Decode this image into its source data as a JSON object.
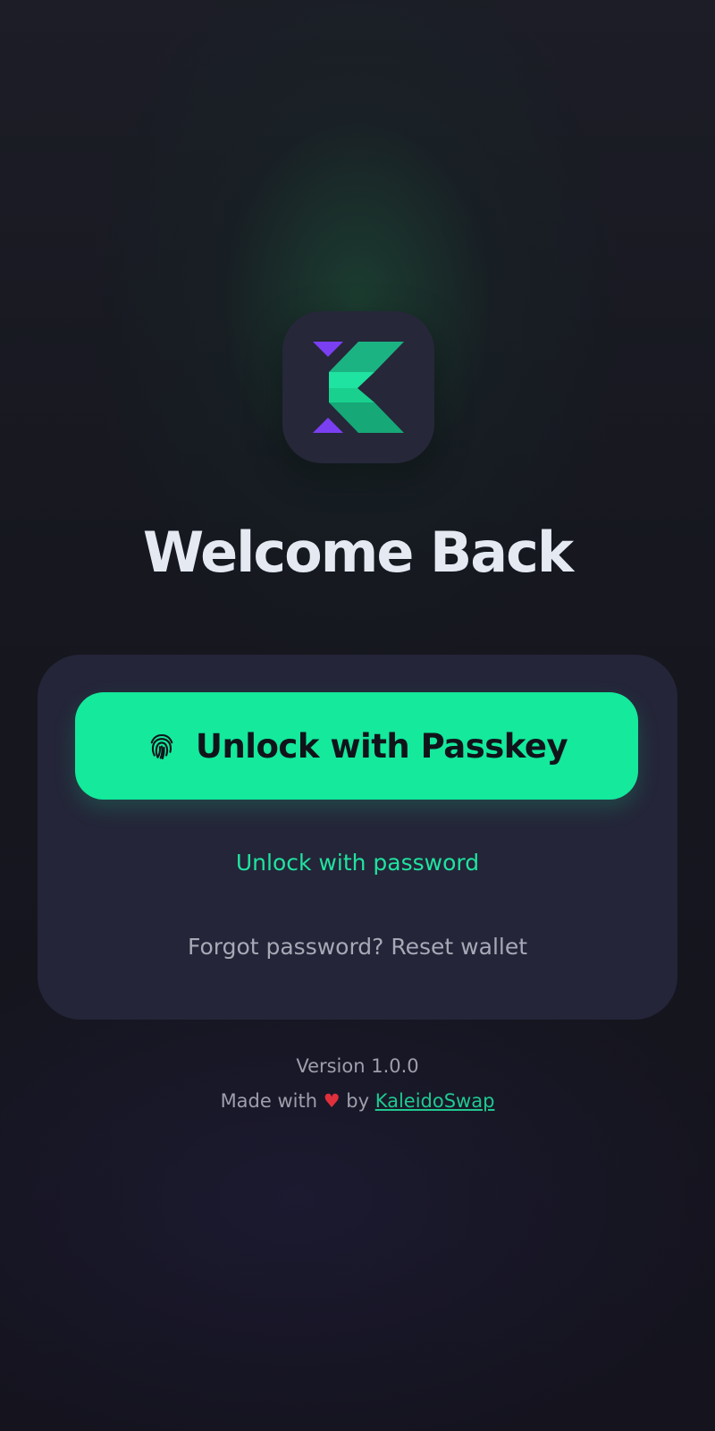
{
  "app": {
    "logo_icon": "kaleidoswap-logo-icon"
  },
  "header": {
    "title": "Welcome Back"
  },
  "unlock": {
    "passkey_button_label": "Unlock with Passkey",
    "passkey_icon": "fingerprint-icon",
    "password_link_label": "Unlock with password",
    "reset_link_label": "Forgot password? Reset wallet"
  },
  "footer": {
    "version": "Version 1.0.0",
    "made_with_prefix": "Made with",
    "heart": "♥",
    "by": "by",
    "brand_link": "KaleidoSwap"
  },
  "colors": {
    "accent": "#14e99c",
    "link": "#1fe3a0",
    "background": "#15141f",
    "card": "#242538",
    "logo_purple": "#7b3ff2",
    "heart": "#e0303c"
  }
}
